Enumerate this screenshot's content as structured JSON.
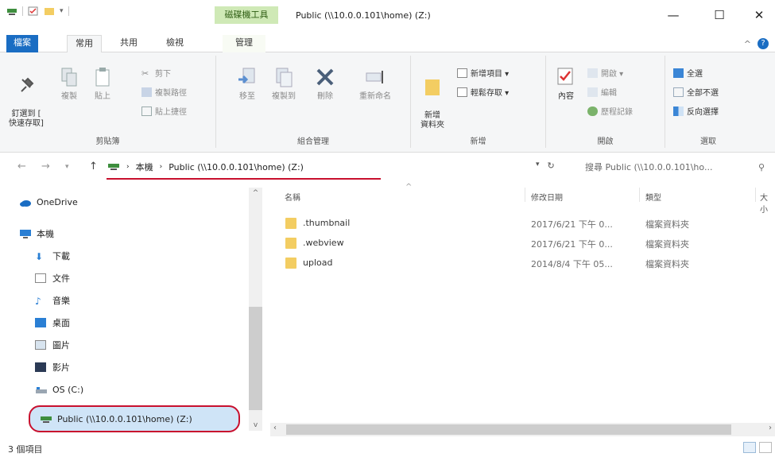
{
  "window": {
    "title": "Public (\\\\10.0.0.101\\home) (Z:)",
    "context_tab": "磁碟機工具",
    "controls": {
      "minimize": "—",
      "maximize": "☐",
      "close": "✕"
    }
  },
  "ribbon_tabs": {
    "file": "檔案",
    "home": "常用",
    "share": "共用",
    "view": "檢視",
    "manage": "管理",
    "collapse": "^",
    "help": "?"
  },
  "clipboard": {
    "label": "剪貼簿",
    "pin": "釘選到 [\n快速存取]",
    "copy": "複製",
    "paste": "貼上",
    "cut": "剪下",
    "copy_path": "複製路徑",
    "paste_shortcut": "貼上捷徑"
  },
  "organize": {
    "label": "組合管理",
    "move_to": "移至",
    "copy_to": "複製到",
    "delete": "刪除",
    "rename": "重新命名"
  },
  "new_group": {
    "label": "新增",
    "new_folder": "新增\n資料夾",
    "new_item": "新增項目 ▾",
    "easy_access": "輕鬆存取 ▾"
  },
  "open_group": {
    "label": "開啟",
    "properties": "內容",
    "open": "開啟 ▾",
    "edit": "編輯",
    "history": "歷程記錄"
  },
  "select_group": {
    "label": "選取",
    "select_all": "全選",
    "select_none": "全部不選",
    "invert": "反向選擇"
  },
  "address": {
    "root": "本機",
    "path": "Public (\\\\10.0.0.101\\home) (Z:)",
    "search_placeholder": "搜尋 Public (\\\\10.0.0.101\\ho..."
  },
  "nav_items": [
    {
      "label": "OneDrive"
    },
    {
      "label": "本機"
    },
    {
      "label": "下載"
    },
    {
      "label": "文件"
    },
    {
      "label": "音樂"
    },
    {
      "label": "桌面"
    },
    {
      "label": "圖片"
    },
    {
      "label": "影片"
    },
    {
      "label": "OS (C:)"
    },
    {
      "label": "Public (\\\\10.0.0.101\\home) (Z:)"
    }
  ],
  "columns": {
    "name": "名稱",
    "date": "修改日期",
    "type": "類型",
    "size": "大小"
  },
  "files": [
    {
      "name": ".thumbnail",
      "date": "2017/6/21 下午 0...",
      "type": "檔案資料夾"
    },
    {
      "name": ".webview",
      "date": "2017/6/21 下午 0...",
      "type": "檔案資料夾"
    },
    {
      "name": "upload",
      "date": "2014/8/4 下午 05...",
      "type": "檔案資料夾"
    }
  ],
  "status": {
    "count": "3 個項目"
  },
  "colors": {
    "accent": "#1a6dc3",
    "highlight": "#c8102e",
    "folder": "#f3cd62",
    "selected": "#cfe4f7"
  }
}
